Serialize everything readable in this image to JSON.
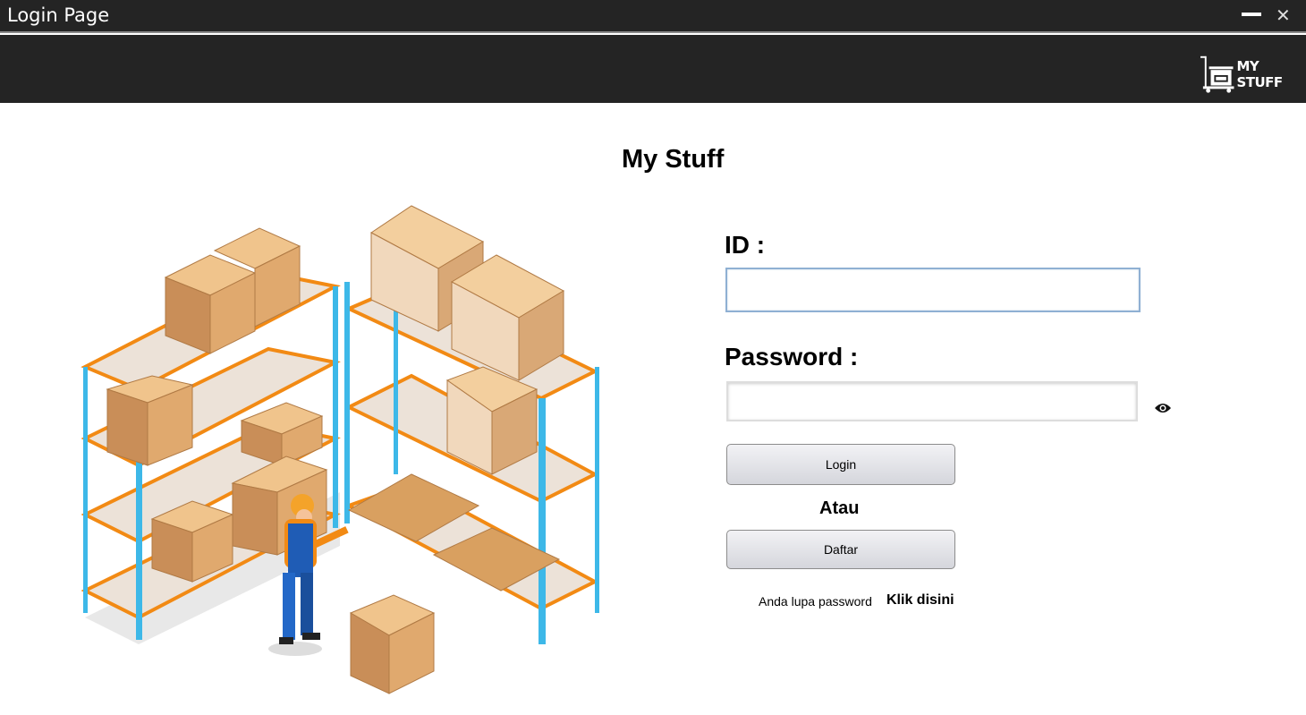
{
  "window": {
    "title": "Login Page",
    "minimize": "—",
    "close": "✕"
  },
  "header": {
    "logo_text": "MY STUFF"
  },
  "main": {
    "title": "My Stuff",
    "id_label": "ID :",
    "id_value": "",
    "password_label": "Password :",
    "password_value": "",
    "login_button": "Login",
    "or_text": "Atau",
    "register_button": "Daftar",
    "forgot_text": "Anda lupa password",
    "forgot_link": "Klik disini"
  },
  "icons": {
    "eye": "eye-icon",
    "logo": "cart-box-icon",
    "illustration": "warehouse-illustration"
  }
}
